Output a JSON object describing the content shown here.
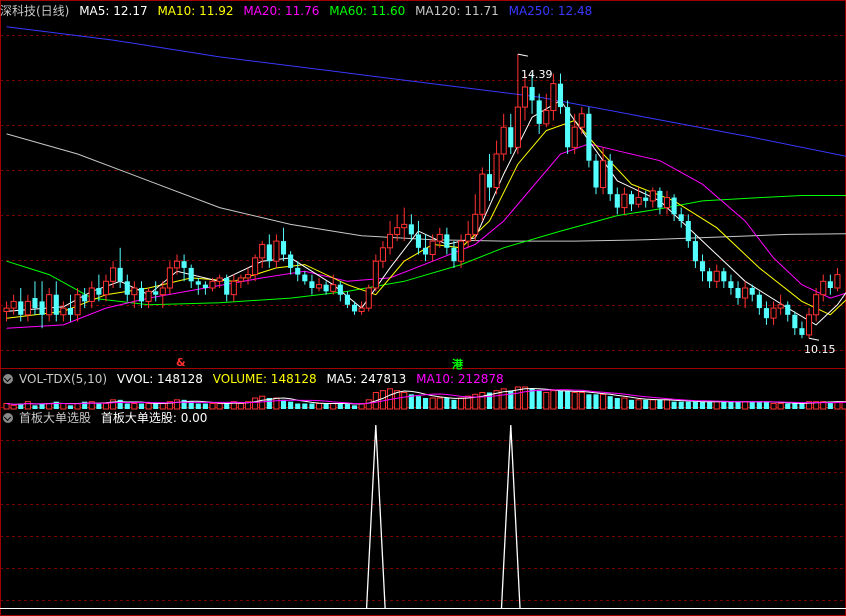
{
  "colors": {
    "up": "#ff3232",
    "down": "#54ffff",
    "bg": "#000000",
    "grid": "#7a0000",
    "border": "#a00000",
    "ma5": "#ffffff",
    "ma10": "#ffff00",
    "ma20": "#ff00ff",
    "ma60": "#00ff00",
    "ma120": "#c8c8c8",
    "ma250": "#3838ff"
  },
  "main_panel": {
    "title": "深科技(日线)",
    "ma5": "MA5: 12.17",
    "ma10": "MA10: 11.92",
    "ma20": "MA20: 11.76",
    "ma60": "MA60: 11.60",
    "ma120": "MA120: 11.71",
    "ma250": "MA250: 12.48",
    "high_label": "14.39",
    "low_label": "10.15",
    "marker_left": "&",
    "marker_right": "港"
  },
  "vol_panel": {
    "title": "VOL-TDX(5,10)",
    "vvol": "VVOL: 148128",
    "volume": "VOLUME: 148128",
    "ma5": "MA5: 247813",
    "ma10": "MA10: 212878"
  },
  "ind_panel": {
    "title": "首板大单选股",
    "series_label": "首板大单选股: 0.00"
  },
  "chart_data": {
    "type": "candlestick",
    "ylim": [
      9.9,
      14.9
    ],
    "high": 14.39,
    "low": 10.15,
    "candles": [
      [
        10.55,
        10.6,
        10.4,
        10.7
      ],
      [
        10.6,
        10.7,
        10.5,
        10.8
      ],
      [
        10.7,
        10.5,
        10.4,
        10.9
      ],
      [
        10.5,
        10.7,
        10.4,
        10.8
      ],
      [
        10.75,
        10.6,
        10.5,
        11.0
      ],
      [
        10.7,
        10.5,
        10.3,
        11.0
      ],
      [
        10.5,
        10.8,
        10.4,
        10.9
      ],
      [
        10.8,
        10.5,
        10.4,
        11.0
      ],
      [
        10.5,
        10.6,
        10.4,
        10.7
      ],
      [
        10.6,
        10.5,
        10.4,
        10.8
      ],
      [
        10.5,
        10.8,
        10.4,
        10.9
      ],
      [
        10.8,
        10.7,
        10.6,
        10.9
      ],
      [
        10.7,
        10.9,
        10.6,
        11.0
      ],
      [
        10.9,
        10.8,
        10.7,
        11.1
      ],
      [
        10.8,
        11.0,
        10.7,
        11.1
      ],
      [
        11.0,
        11.2,
        10.9,
        11.3
      ],
      [
        11.2,
        11.0,
        10.9,
        11.5
      ],
      [
        11.0,
        10.8,
        10.7,
        11.1
      ],
      [
        10.8,
        10.9,
        10.6,
        11.0
      ],
      [
        10.9,
        10.7,
        10.6,
        11.0
      ],
      [
        10.7,
        10.85,
        10.6,
        10.9
      ],
      [
        10.85,
        10.8,
        10.7,
        11.0
      ],
      [
        10.8,
        10.9,
        10.6,
        11.0
      ],
      [
        10.9,
        11.2,
        10.8,
        11.3
      ],
      [
        11.2,
        11.3,
        11.1,
        11.4
      ],
      [
        11.3,
        11.2,
        11.0,
        11.4
      ],
      [
        11.2,
        11.0,
        10.9,
        11.25
      ],
      [
        11.0,
        10.95,
        10.8,
        11.05
      ],
      [
        10.95,
        10.9,
        10.8,
        11.0
      ],
      [
        10.9,
        11.0,
        10.85,
        11.05
      ],
      [
        11.0,
        11.05,
        10.9,
        11.1
      ],
      [
        11.05,
        10.8,
        10.7,
        11.1
      ],
      [
        10.8,
        11.0,
        10.7,
        11.1
      ],
      [
        11.0,
        11.05,
        10.9,
        11.1
      ],
      [
        11.05,
        11.1,
        10.95,
        11.2
      ],
      [
        11.1,
        11.35,
        11.0,
        11.4
      ],
      [
        11.35,
        11.55,
        11.2,
        11.6
      ],
      [
        11.55,
        11.3,
        11.2,
        11.7
      ],
      [
        11.3,
        11.6,
        11.2,
        11.7
      ],
      [
        11.6,
        11.4,
        11.3,
        11.8
      ],
      [
        11.4,
        11.2,
        11.1,
        11.45
      ],
      [
        11.2,
        11.1,
        11.0,
        11.3
      ],
      [
        11.1,
        11.0,
        10.95,
        11.15
      ],
      [
        11.0,
        10.9,
        10.8,
        11.1
      ],
      [
        10.9,
        10.95,
        10.85,
        11.05
      ],
      [
        10.95,
        10.85,
        10.8,
        11.0
      ],
      [
        10.85,
        10.95,
        10.8,
        11.1
      ],
      [
        10.95,
        10.8,
        10.7,
        11.0
      ],
      [
        10.8,
        10.65,
        10.6,
        10.85
      ],
      [
        10.65,
        10.55,
        10.5,
        10.7
      ],
      [
        10.55,
        10.6,
        10.5,
        10.7
      ],
      [
        10.6,
        10.9,
        10.55,
        10.95
      ],
      [
        10.9,
        11.3,
        10.85,
        11.4
      ],
      [
        11.3,
        11.5,
        11.2,
        11.6
      ],
      [
        11.5,
        11.7,
        11.4,
        11.9
      ],
      [
        11.7,
        11.8,
        11.6,
        12.0
      ],
      [
        11.8,
        11.85,
        11.6,
        12.1
      ],
      [
        11.85,
        11.7,
        11.6,
        12.0
      ],
      [
        11.7,
        11.5,
        11.4,
        11.9
      ],
      [
        11.5,
        11.4,
        11.3,
        11.7
      ],
      [
        11.4,
        11.6,
        11.3,
        11.7
      ],
      [
        11.6,
        11.7,
        11.5,
        11.8
      ],
      [
        11.7,
        11.5,
        11.4,
        11.8
      ],
      [
        11.5,
        11.3,
        11.2,
        11.6
      ],
      [
        11.3,
        11.6,
        11.2,
        11.7
      ],
      [
        11.6,
        11.7,
        11.5,
        11.9
      ],
      [
        11.7,
        12.0,
        11.6,
        12.3
      ],
      [
        12.0,
        12.6,
        11.9,
        12.7
      ],
      [
        12.6,
        12.4,
        12.2,
        12.9
      ],
      [
        12.4,
        12.9,
        12.3,
        13.1
      ],
      [
        12.9,
        13.3,
        12.8,
        13.5
      ],
      [
        13.3,
        13.0,
        12.9,
        13.5
      ],
      [
        13.0,
        13.6,
        12.9,
        14.39
      ],
      [
        13.6,
        13.9,
        13.4,
        14.1
      ],
      [
        13.9,
        13.7,
        13.5,
        14.1
      ],
      [
        13.7,
        13.35,
        13.2,
        13.8
      ],
      [
        13.35,
        13.55,
        13.3,
        13.8
      ],
      [
        13.55,
        13.95,
        13.4,
        14.1
      ],
      [
        13.95,
        13.6,
        13.5,
        14.1
      ],
      [
        13.6,
        13.0,
        12.9,
        13.7
      ],
      [
        13.0,
        13.3,
        12.9,
        13.5
      ],
      [
        13.3,
        13.5,
        13.2,
        13.6
      ],
      [
        13.5,
        12.8,
        12.7,
        13.6
      ],
      [
        12.8,
        12.4,
        12.3,
        12.9
      ],
      [
        12.4,
        12.8,
        12.3,
        13.0
      ],
      [
        12.8,
        12.3,
        12.2,
        12.9
      ],
      [
        12.3,
        12.1,
        12.0,
        12.4
      ],
      [
        12.1,
        12.3,
        12.0,
        12.4
      ],
      [
        12.3,
        12.15,
        12.05,
        12.35
      ],
      [
        12.15,
        12.25,
        12.1,
        12.4
      ],
      [
        12.25,
        12.2,
        12.1,
        12.35
      ],
      [
        12.2,
        12.35,
        12.1,
        12.4
      ],
      [
        12.35,
        12.1,
        12.0,
        12.4
      ],
      [
        12.1,
        12.25,
        12.0,
        12.35
      ],
      [
        12.25,
        12.0,
        11.9,
        12.3
      ],
      [
        12.0,
        11.9,
        11.8,
        12.1
      ],
      [
        11.9,
        11.6,
        11.5,
        12.0
      ],
      [
        11.6,
        11.3,
        11.2,
        11.7
      ],
      [
        11.3,
        11.15,
        11.0,
        11.4
      ],
      [
        11.15,
        11.0,
        10.9,
        11.2
      ],
      [
        11.0,
        11.15,
        10.9,
        11.25
      ],
      [
        11.15,
        11.0,
        10.9,
        11.2
      ],
      [
        11.0,
        10.9,
        10.8,
        11.1
      ],
      [
        10.9,
        10.75,
        10.65,
        11.0
      ],
      [
        10.75,
        10.9,
        10.6,
        11.0
      ],
      [
        10.9,
        10.8,
        10.7,
        10.95
      ],
      [
        10.8,
        10.6,
        10.5,
        10.85
      ],
      [
        10.6,
        10.45,
        10.35,
        10.7
      ],
      [
        10.45,
        10.6,
        10.35,
        10.7
      ],
      [
        10.6,
        10.65,
        10.5,
        10.8
      ],
      [
        10.65,
        10.5,
        10.4,
        10.7
      ],
      [
        10.5,
        10.3,
        10.2,
        10.55
      ],
      [
        10.3,
        10.2,
        10.15,
        10.4
      ],
      [
        10.2,
        10.5,
        10.15,
        10.6
      ],
      [
        10.5,
        10.8,
        10.4,
        10.9
      ],
      [
        10.8,
        11.0,
        10.7,
        11.1
      ],
      [
        11.0,
        10.9,
        10.8,
        11.1
      ],
      [
        10.9,
        11.1,
        10.85,
        11.2
      ]
    ],
    "ma_lines": {
      "ma5": [
        [
          0,
          10.55
        ],
        [
          8,
          10.62
        ],
        [
          12,
          10.85
        ],
        [
          16,
          11.0
        ],
        [
          20,
          10.8
        ],
        [
          24,
          11.15
        ],
        [
          30,
          11.0
        ],
        [
          36,
          11.3
        ],
        [
          40,
          11.35
        ],
        [
          46,
          10.95
        ],
        [
          50,
          10.6
        ],
        [
          54,
          11.2
        ],
        [
          58,
          11.75
        ],
        [
          62,
          11.55
        ],
        [
          66,
          11.65
        ],
        [
          70,
          12.6
        ],
        [
          74,
          13.45
        ],
        [
          78,
          13.7
        ],
        [
          82,
          13.1
        ],
        [
          86,
          12.5
        ],
        [
          92,
          12.2
        ],
        [
          98,
          11.6
        ],
        [
          104,
          11.0
        ],
        [
          110,
          10.6
        ],
        [
          114,
          10.35
        ],
        [
          117,
          10.65
        ],
        [
          119,
          10.95
        ]
      ],
      "ma10": [
        [
          0,
          10.45
        ],
        [
          8,
          10.55
        ],
        [
          14,
          10.8
        ],
        [
          20,
          10.9
        ],
        [
          26,
          11.05
        ],
        [
          32,
          11.0
        ],
        [
          38,
          11.2
        ],
        [
          42,
          11.25
        ],
        [
          48,
          10.95
        ],
        [
          52,
          10.8
        ],
        [
          56,
          11.3
        ],
        [
          60,
          11.55
        ],
        [
          64,
          11.5
        ],
        [
          68,
          11.9
        ],
        [
          72,
          12.75
        ],
        [
          76,
          13.25
        ],
        [
          80,
          13.4
        ],
        [
          84,
          12.9
        ],
        [
          88,
          12.45
        ],
        [
          94,
          12.2
        ],
        [
          100,
          11.8
        ],
        [
          106,
          11.2
        ],
        [
          112,
          10.7
        ],
        [
          116,
          10.5
        ],
        [
          119,
          10.8
        ]
      ],
      "ma20": [
        [
          0,
          10.3
        ],
        [
          8,
          10.35
        ],
        [
          14,
          10.6
        ],
        [
          20,
          10.75
        ],
        [
          28,
          10.9
        ],
        [
          36,
          11.05
        ],
        [
          42,
          11.15
        ],
        [
          48,
          11.0
        ],
        [
          54,
          11.05
        ],
        [
          60,
          11.3
        ],
        [
          66,
          11.55
        ],
        [
          70,
          11.9
        ],
        [
          74,
          12.4
        ],
        [
          78,
          12.9
        ],
        [
          82,
          13.05
        ],
        [
          86,
          12.95
        ],
        [
          92,
          12.8
        ],
        [
          98,
          12.45
        ],
        [
          104,
          11.9
        ],
        [
          108,
          11.35
        ],
        [
          112,
          10.95
        ],
        [
          116,
          10.75
        ],
        [
          119,
          10.85
        ]
      ],
      "ma60": [
        [
          0,
          11.3
        ],
        [
          6,
          11.1
        ],
        [
          12,
          10.75
        ],
        [
          20,
          10.65
        ],
        [
          30,
          10.68
        ],
        [
          40,
          10.75
        ],
        [
          48,
          10.85
        ],
        [
          56,
          11.0
        ],
        [
          64,
          11.25
        ],
        [
          70,
          11.5
        ],
        [
          78,
          11.75
        ],
        [
          86,
          11.98
        ],
        [
          92,
          12.08
        ],
        [
          98,
          12.2
        ],
        [
          106,
          12.25
        ],
        [
          112,
          12.28
        ],
        [
          119,
          12.28
        ]
      ],
      "ma120": [
        [
          0,
          13.2
        ],
        [
          10,
          12.9
        ],
        [
          20,
          12.5
        ],
        [
          30,
          12.1
        ],
        [
          40,
          11.85
        ],
        [
          50,
          11.68
        ],
        [
          60,
          11.62
        ],
        [
          70,
          11.6
        ],
        [
          80,
          11.6
        ],
        [
          90,
          11.62
        ],
        [
          100,
          11.66
        ],
        [
          110,
          11.7
        ],
        [
          119,
          11.71
        ]
      ],
      "ma250": [
        [
          0,
          14.8
        ],
        [
          15,
          14.6
        ],
        [
          30,
          14.35
        ],
        [
          45,
          14.15
        ],
        [
          60,
          13.95
        ],
        [
          75,
          13.75
        ],
        [
          90,
          13.45
        ],
        [
          105,
          13.15
        ],
        [
          119,
          12.85
        ]
      ]
    },
    "volume": [
      3,
      2,
      3,
      4,
      2,
      3,
      3,
      4,
      3,
      2,
      3,
      4,
      4,
      3,
      3,
      5,
      5,
      3,
      3,
      3,
      3,
      3,
      3,
      4,
      5,
      5,
      4,
      3,
      3,
      3,
      3,
      3,
      4,
      3,
      4,
      6,
      7,
      6,
      6,
      5,
      4,
      3,
      3,
      3,
      3,
      3,
      3,
      3,
      3,
      2,
      3,
      5,
      9,
      10,
      11,
      10,
      9,
      8,
      7,
      6,
      6,
      6,
      6,
      5,
      6,
      7,
      8,
      9,
      9,
      10,
      11,
      10,
      12,
      12,
      11,
      10,
      9,
      10,
      10,
      10,
      9,
      9,
      8,
      8,
      8,
      7,
      6,
      6,
      5,
      5,
      5,
      5,
      5,
      5,
      4,
      4,
      4,
      4,
      4,
      4,
      4,
      4,
      4,
      4,
      4,
      4,
      4,
      4,
      3,
      3,
      3,
      3,
      3,
      4,
      4,
      4,
      4,
      4,
      4,
      4
    ],
    "indicator": {
      "spikes": [
        52,
        71
      ],
      "max": 1
    }
  }
}
